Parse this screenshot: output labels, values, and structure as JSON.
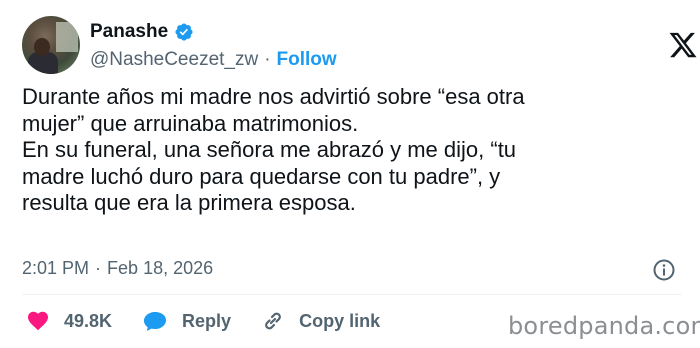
{
  "author": {
    "name": "Panashe",
    "handle": "@NasheCeezet_zw",
    "follow_label": "Follow",
    "verified": true
  },
  "tweet": {
    "text": "Durante años mi madre nos advirtió sobre “esa otra\nmujer” que arruinaba matrimonios.\nEn su funeral, una señora me abrazó y me dijo, “tu\nmadre luchó duro para quedarse con tu padre”, y\nresulta que era la primera esposa.",
    "time": "2:01 PM",
    "separator": "·",
    "date": "Feb 18, 2026"
  },
  "actions": {
    "likes": "49.8K",
    "reply_label": "Reply",
    "copy_link_label": "Copy link"
  },
  "watermark": "boredpanda.com",
  "colors": {
    "accent": "#1d9bf0",
    "like": "#f91880",
    "muted": "#536471",
    "text": "#0f1419"
  },
  "icons": [
    "verified-badge-icon",
    "x-logo-icon",
    "info-icon",
    "heart-icon",
    "reply-bubble-icon",
    "link-icon"
  ]
}
